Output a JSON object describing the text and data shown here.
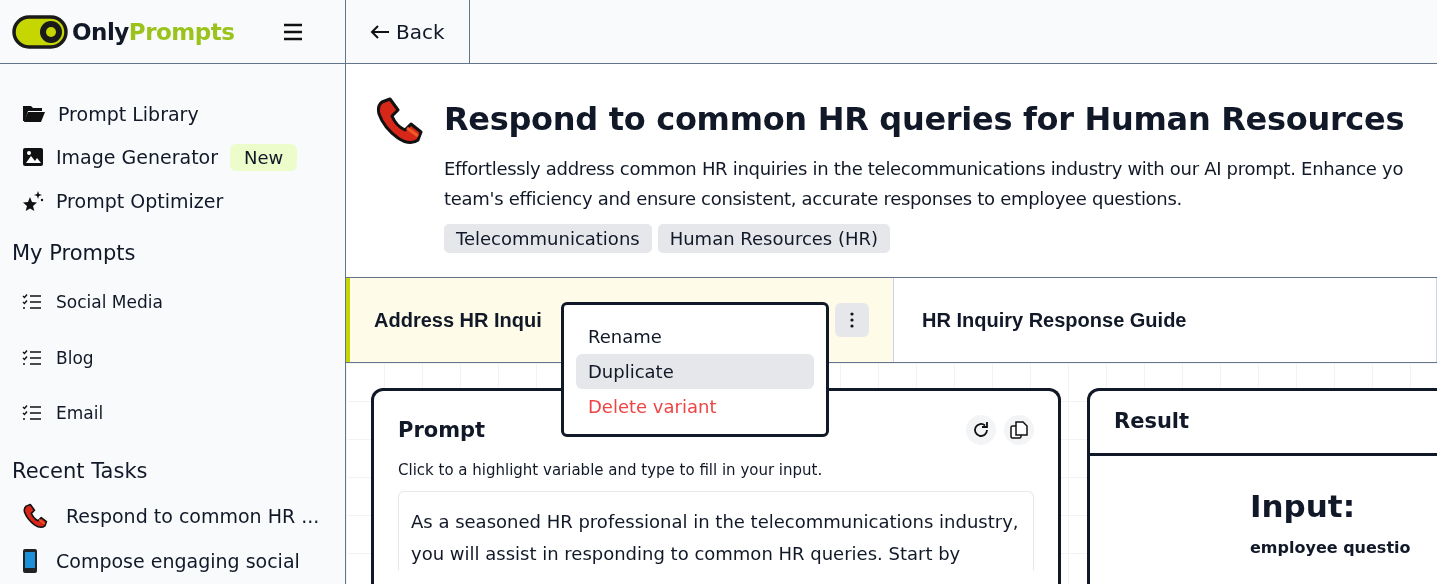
{
  "logo": {
    "parts": [
      "Only",
      "Prompts"
    ]
  },
  "back_button": {
    "label": "Back"
  },
  "sidebar": {
    "nav": [
      {
        "kind": "folder",
        "label": "Prompt Library"
      },
      {
        "kind": "image",
        "label": "Image Generator",
        "badge": "New"
      },
      {
        "kind": "sparkle",
        "label": "Prompt Optimizer"
      }
    ],
    "my_prompts": {
      "heading": "My Prompts",
      "items": [
        "Social Media",
        "Blog",
        "Email"
      ]
    },
    "recent_tasks": {
      "heading": "Recent Tasks",
      "items": [
        {
          "kind": "phone",
          "label": "Respond to common HR ..."
        },
        {
          "kind": "mobile",
          "label": "Compose engaging social"
        }
      ]
    }
  },
  "task": {
    "title": "Respond to common HR queries for Human Resources",
    "description_lines": [
      "Effortlessly address common HR inquiries in the telecommunications industry with our AI prompt. Enhance yo",
      "team's efficiency and ensure consistent, accurate responses to employee questions."
    ],
    "tags": [
      "Telecommunications",
      "Human Resources (HR)"
    ]
  },
  "variants": [
    {
      "label": "Address HR Inqui",
      "selected": true
    },
    {
      "label": "HR Inquiry Response Guide",
      "selected": false
    }
  ],
  "variant_menu": {
    "items": [
      {
        "label": "Rename",
        "kind": "normal",
        "highlighted": false
      },
      {
        "label": "Duplicate",
        "kind": "normal",
        "highlighted": true
      },
      {
        "label": "Delete variant",
        "kind": "danger",
        "highlighted": false
      }
    ]
  },
  "prompt_panel": {
    "title": "Prompt",
    "hint": "Click to a highlight variable and type to fill in your input.",
    "text_lines": [
      "As a seasoned HR professional in the telecommunications industry,",
      "you will assist in responding to common HR queries. Start by"
    ]
  },
  "result_panel": {
    "title": "Result",
    "heading": "Input:",
    "subheading": "employee questio"
  }
}
